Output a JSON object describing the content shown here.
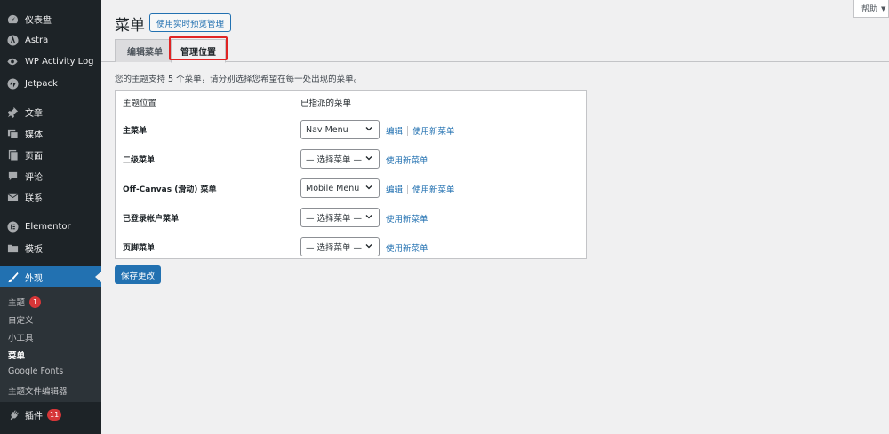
{
  "sidebar": {
    "items": [
      {
        "label": "仪表盘",
        "icon": "dashboard-icon"
      },
      {
        "label": "Astra",
        "icon": "astra-icon"
      },
      {
        "label": "WP Activity Log",
        "icon": "eye-icon"
      },
      {
        "label": "Jetpack",
        "icon": "jetpack-icon"
      },
      {
        "label": "文章",
        "icon": "pin-icon"
      },
      {
        "label": "媒体",
        "icon": "media-icon"
      },
      {
        "label": "页面",
        "icon": "page-icon"
      },
      {
        "label": "评论",
        "icon": "comment-icon"
      },
      {
        "label": "联系",
        "icon": "mail-icon"
      },
      {
        "label": "Elementor",
        "icon": "elementor-icon"
      },
      {
        "label": "模板",
        "icon": "folder-icon"
      },
      {
        "label": "外观",
        "icon": "brush-icon"
      },
      {
        "label": "插件",
        "icon": "plugin-icon"
      }
    ],
    "submenu": [
      {
        "label": "主题",
        "badge": "1"
      },
      {
        "label": "自定义"
      },
      {
        "label": "小工具"
      },
      {
        "label": "菜单"
      },
      {
        "label": "Google Fonts"
      },
      {
        "label": "主题文件编辑器"
      }
    ],
    "plugins_badge": "11"
  },
  "help": {
    "label": "帮助"
  },
  "header": {
    "title": "菜单",
    "preview_button": "使用实时预览管理"
  },
  "tabs": [
    {
      "label": "编辑菜单"
    },
    {
      "label": "管理位置"
    }
  ],
  "intro": "您的主题支持 5 个菜单，请分别选择您希望在每一处出现的菜单。",
  "table": {
    "col_location": "主题位置",
    "col_assigned": "已指派的菜单",
    "rows": [
      {
        "label": "主菜单",
        "selected": "Nav Menu",
        "edit": "编辑",
        "new": "使用新菜单"
      },
      {
        "label": "二级菜单",
        "selected": "— 选择菜单 —",
        "new": "使用新菜单"
      },
      {
        "label": "Off-Canvas (滑动) 菜单",
        "selected": "Mobile Menu",
        "edit": "编辑",
        "new": "使用新菜单"
      },
      {
        "label": "已登录帐户菜单",
        "selected": "— 选择菜单 —",
        "new": "使用新菜单"
      },
      {
        "label": "页脚菜单",
        "selected": "— 选择菜单 —",
        "new": "使用新菜单"
      }
    ]
  },
  "save_button": "保存更改",
  "colors": {
    "accent": "#2271b1",
    "sidebar": "#1d2327",
    "badge": "#d63638",
    "highlight": "#e02424"
  }
}
